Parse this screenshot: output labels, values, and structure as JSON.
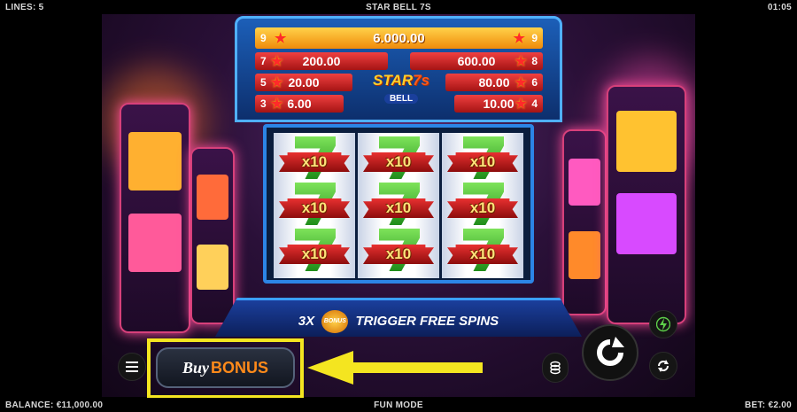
{
  "topbar": {
    "lines": "LINES: 5",
    "title": "STAR BELL 7S",
    "clock": "01:05"
  },
  "bottombar": {
    "balance": "BALANCE: €11,000.00",
    "mode": "FUN MODE",
    "bet": "BET: €2.00"
  },
  "paytable": {
    "rows": [
      {
        "left_count": "9",
        "left_value": "6.000.00",
        "right_count": "9"
      },
      {
        "left_count": "7",
        "left_value": "200.00",
        "right_value": "600.00",
        "right_count": "8"
      },
      {
        "left_count": "5",
        "left_value": "20.00",
        "right_value": "80.00",
        "right_count": "6"
      },
      {
        "left_count": "3",
        "left_value": "6.00",
        "right_value": "10.00",
        "right_count": "4"
      }
    ]
  },
  "logo": {
    "line1": "STAR",
    "line2": "BELL",
    "seven": "7s"
  },
  "reels": {
    "symbol": "green-seven",
    "columns": [
      [
        "x10",
        "x10",
        "x10"
      ],
      [
        "x10",
        "x10",
        "x10"
      ],
      [
        "x10",
        "x10",
        "x10"
      ]
    ]
  },
  "trigger": {
    "prefix": "3X",
    "badge": "BONUS",
    "text": "TRIGGER FREE SPINS"
  },
  "controls": {
    "buy_word": "Buy",
    "bonus_word": "BONUS",
    "menu_icon": "hamburger-icon",
    "coin_icon": "coin-stack-icon",
    "spin_icon": "spin-arrow-icon",
    "autoplay_icon": "autoplay-icon",
    "turbo_icon": "lightning-icon"
  },
  "colors": {
    "highlight": "#f4e520",
    "arrow": "#f4e520",
    "bonus_text": "#ff8a1a"
  }
}
